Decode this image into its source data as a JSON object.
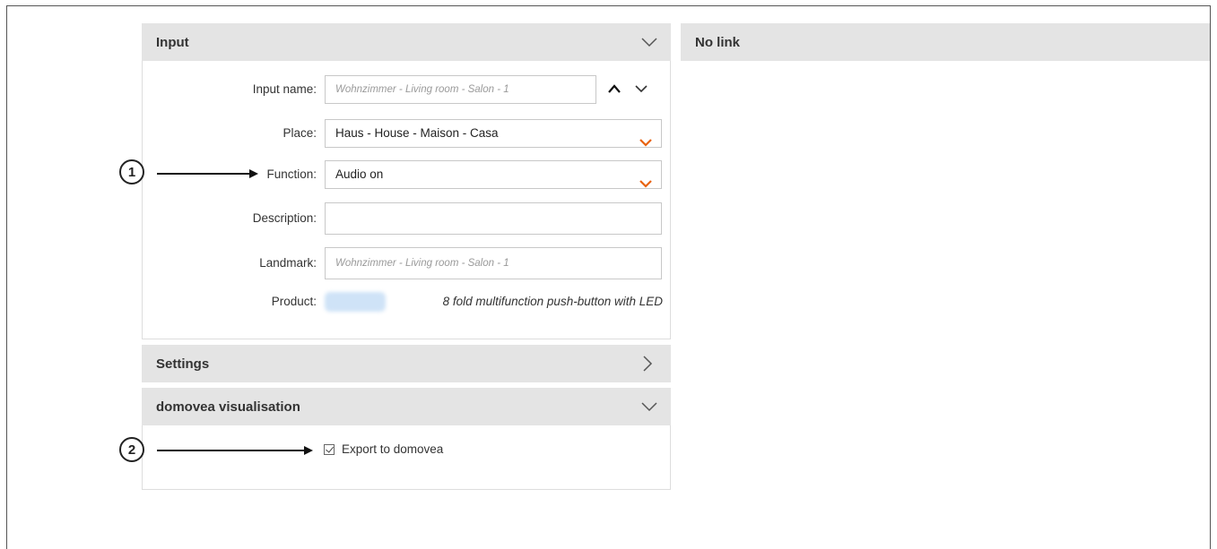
{
  "input_panel": {
    "title": "Input",
    "fields": {
      "input_name": {
        "label": "Input name:",
        "value": "Wohnzimmer - Living room - Salon - 1"
      },
      "place": {
        "label": "Place:",
        "value": "Haus - House - Maison - Casa"
      },
      "function": {
        "label": "Function:",
        "value": "Audio on"
      },
      "description": {
        "label": "Description:",
        "value": ""
      },
      "landmark": {
        "label": "Landmark:",
        "value": "Wohnzimmer - Living room - Salon - 1"
      },
      "product": {
        "label": "Product:",
        "description": "8 fold multifunction push-button with LED"
      }
    }
  },
  "settings_panel": {
    "title": "Settings"
  },
  "visualisation_panel": {
    "title": "domovea visualisation",
    "export_label": "Export to domovea",
    "export_checked": true
  },
  "link_panel": {
    "title": "No link"
  },
  "annotations": {
    "one": "1",
    "two": "2"
  },
  "colors": {
    "accent": "#e8620f",
    "header_bg": "#e4e4e4"
  }
}
